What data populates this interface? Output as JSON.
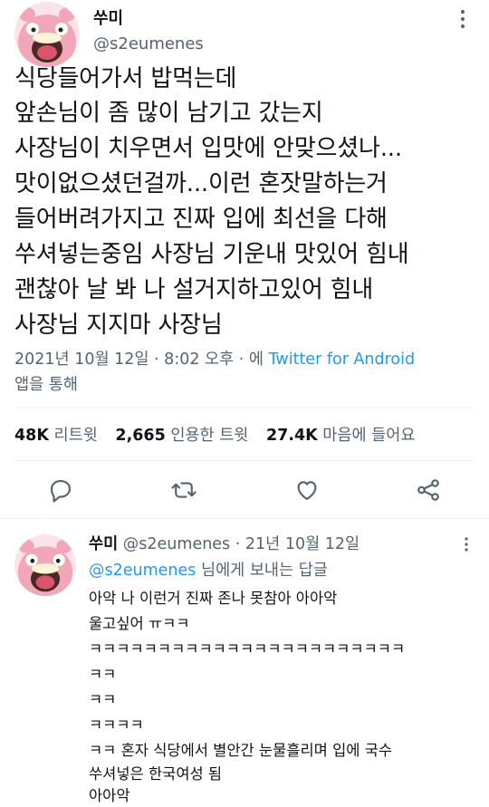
{
  "main_tweet": {
    "avatar_icon": "slowpoke-avatar-icon",
    "display_name": "쑤미",
    "handle": "@s2eumenes",
    "body_lines": [
      "식당들어가서 밥먹는데",
      "앞손님이 좀 많이 남기고 갔는지",
      "사장님이 치우면서 입맛에 안맞으셨나...",
      "맛이없으셨던걸까...이런 혼잣말하는거",
      "들어버려가지고 진짜 입에 최선을 다해",
      "쑤셔넣는중임 사장님 기운내 맛있어 힘내",
      "괜찮아 날 봐 나 설거지하고있어 힘내",
      "사장님 지지마 사장님"
    ],
    "timestamp": "2021년 10월 12일 · 8:02 오후 · 에 ",
    "source": "Twitter for Android",
    "source_suffix": "앱을 통해",
    "stats": {
      "retweets_count": "48K",
      "retweets_label": "리트윗",
      "quotes_count": "2,665",
      "quotes_label": "인용한 트윗",
      "likes_count": "27.4K",
      "likes_label": "마음에 들어요"
    },
    "actions": [
      "reply-icon",
      "retweet-icon",
      "like-icon",
      "share-icon"
    ]
  },
  "reply_tweet": {
    "avatar_icon": "slowpoke-avatar-icon",
    "display_name": "쑤미",
    "handle": "@s2eumenes",
    "date": "· 21년 10월 12일",
    "replying_handle": "@s2eumenes",
    "replying_suffix": " 님에게 보내는 답글",
    "body_lines": [
      "아악 나 이런거 진짜 존나 못참아 아아악",
      "울고싶어 ㅠㅋㅋ",
      "ㅋㅋㅋㅋㅋㅋㅋㅋㅋㅋㅋㅋㅋㅋㅋㅋㅋㅋㅋㅋㅋㅋㅋ",
      "ㅋㅋ",
      "ㅋㅋ",
      "ㅋㅋㅋㅋ",
      "ㅋㅋ 혼자 식당에서 별안간 눈물흘리며 입에 국수",
      "쑤셔넣은 한국여성 됨",
      "아아악"
    ]
  },
  "colors": {
    "text": "#0f1419",
    "secondary": "#536471",
    "link": "#1d9bf0",
    "avatar_pink": "#f2a7b8"
  }
}
